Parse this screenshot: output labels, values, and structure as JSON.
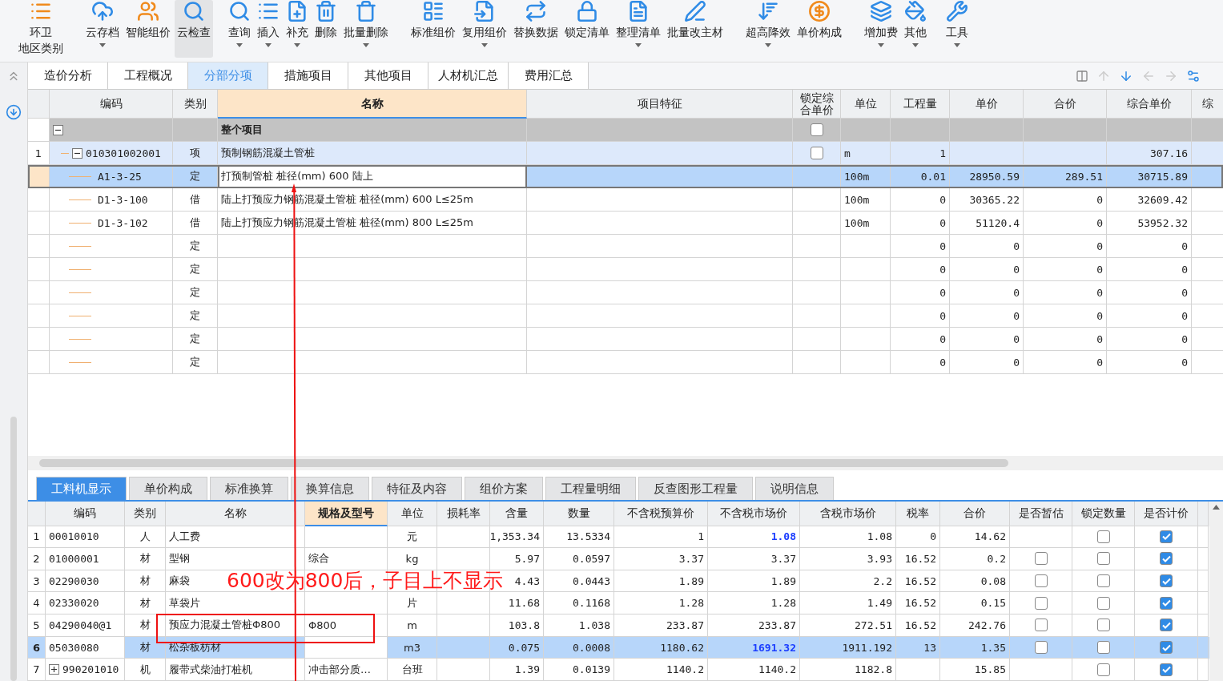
{
  "toolbar": [
    {
      "label": "环卫",
      "label_2": "地区类别",
      "dropdown": false,
      "pressed": false
    },
    {
      "label": "云存档",
      "dropdown": true,
      "pressed": false
    },
    {
      "label": "智能组价",
      "dropdown": false,
      "pressed": false
    },
    {
      "label": "云检查",
      "dropdown": false,
      "pressed": true
    },
    {
      "label": "查询",
      "dropdown": true,
      "pressed": false
    },
    {
      "label": "插入",
      "dropdown": true,
      "pressed": false
    },
    {
      "label": "补充",
      "dropdown": true,
      "pressed": false
    },
    {
      "label": "删除",
      "dropdown": false,
      "pressed": false
    },
    {
      "label": "批量删除",
      "dropdown": true,
      "pressed": false
    },
    {
      "label": "标准组价",
      "dropdown": false,
      "pressed": false
    },
    {
      "label": "复用组价",
      "dropdown": true,
      "pressed": false
    },
    {
      "label": "替换数据",
      "dropdown": false,
      "pressed": false
    },
    {
      "label": "锁定清单",
      "dropdown": false,
      "pressed": false
    },
    {
      "label": "整理清单",
      "dropdown": true,
      "pressed": false
    },
    {
      "label": "批量改主材",
      "dropdown": false,
      "pressed": false
    },
    {
      "label": "超高降效",
      "dropdown": true,
      "pressed": false
    },
    {
      "label": "单价构成",
      "dropdown": false,
      "pressed": false
    },
    {
      "label": "增加费",
      "dropdown": true,
      "pressed": false
    },
    {
      "label": "其他",
      "dropdown": true,
      "pressed": false
    },
    {
      "label": "工具",
      "dropdown": true,
      "pressed": false
    }
  ],
  "tabs": [
    {
      "label": "造价分析",
      "selected": false
    },
    {
      "label": "工程概况",
      "selected": false
    },
    {
      "label": "分部分项",
      "selected": true
    },
    {
      "label": "措施项目",
      "selected": false
    },
    {
      "label": "其他项目",
      "selected": false
    },
    {
      "label": "人材机汇总",
      "selected": false
    },
    {
      "label": "费用汇总",
      "selected": false
    }
  ],
  "upper_table": {
    "columns": [
      {
        "label": "编码",
        "selected": false
      },
      {
        "label": "类别",
        "selected": false
      },
      {
        "label": "名称",
        "selected": true
      },
      {
        "label": "项目特征",
        "selected": false
      },
      {
        "label": "锁定综合单价",
        "selected": false
      },
      {
        "label": "单位",
        "selected": false
      },
      {
        "label": "工程量",
        "selected": false
      },
      {
        "label": "单价",
        "selected": false
      },
      {
        "label": "合价",
        "selected": false
      },
      {
        "label": "综合单价",
        "selected": false
      },
      {
        "label": "综",
        "selected": false
      }
    ],
    "rows": [
      {
        "name": "整个项目",
        "kind": "section",
        "expanded": true,
        "locked": false,
        "selected": false,
        "children": [
          {
            "number": "1",
            "code": "010301002001",
            "type": "项",
            "name": "预制钢筋混凝土管桩",
            "kind": "item",
            "expanded": true,
            "locked": false,
            "selected": false,
            "unit": "m",
            "quantity": "1",
            "composite_price": "307.16",
            "children": [
              {
                "code": "A1-3-25",
                "type": "定",
                "name": "打预制管桩 桩径(mm) 600 陆上",
                "kind": "quota",
                "selected": true,
                "unit": "100m",
                "quantity": "0.01",
                "unit_price": "28950.59",
                "total": "289.51",
                "composite_price": "30715.89"
              },
              {
                "code": "D1-3-100",
                "type": "借",
                "name": "陆上打预应力钢筋混凝土管桩 桩径(mm) 600 L≤25m",
                "kind": "quota",
                "selected": false,
                "unit": "100m",
                "quantity": "0",
                "unit_price": "30365.22",
                "total": "0",
                "composite_price": "32609.42"
              },
              {
                "code": "D1-3-102",
                "type": "借",
                "name": "陆上打预应力钢筋混凝土管桩 桩径(mm) 800 L≤25m",
                "kind": "quota",
                "selected": false,
                "unit": "100m",
                "quantity": "0",
                "unit_price": "51120.4",
                "total": "0",
                "composite_price": "53952.32"
              },
              {
                "type": "定",
                "kind": "quota",
                "selected": false,
                "quantity": "0",
                "unit_price": "0",
                "total": "0",
                "composite_price": "0"
              },
              {
                "type": "定",
                "kind": "quota",
                "selected": false,
                "quantity": "0",
                "unit_price": "0",
                "total": "0",
                "composite_price": "0"
              },
              {
                "type": "定",
                "kind": "quota",
                "selected": false,
                "quantity": "0",
                "unit_price": "0",
                "total": "0",
                "composite_price": "0"
              },
              {
                "type": "定",
                "kind": "quota",
                "selected": false,
                "quantity": "0",
                "unit_price": "0",
                "total": "0",
                "composite_price": "0"
              },
              {
                "type": "定",
                "kind": "quota",
                "selected": false,
                "quantity": "0",
                "unit_price": "0",
                "total": "0",
                "composite_price": "0"
              },
              {
                "type": "定",
                "kind": "quota",
                "selected": false,
                "quantity": "0",
                "unit_price": "0",
                "total": "0",
                "composite_price": "0"
              }
            ]
          }
        ]
      }
    ]
  },
  "lower_tabs": [
    {
      "label": "工料机显示",
      "selected": true
    },
    {
      "label": "单价构成",
      "selected": false
    },
    {
      "label": "标准换算",
      "selected": false
    },
    {
      "label": "换算信息",
      "selected": false
    },
    {
      "label": "特征及内容",
      "selected": false
    },
    {
      "label": "组价方案",
      "selected": false
    },
    {
      "label": "工程量明细",
      "selected": false
    },
    {
      "label": "反查图形工程量",
      "selected": false
    },
    {
      "label": "说明信息",
      "selected": false
    }
  ],
  "lower_table": {
    "columns": [
      {
        "label": "编码",
        "selected": false
      },
      {
        "label": "类别",
        "selected": false
      },
      {
        "label": "名称",
        "selected": false
      },
      {
        "label": "规格及型号",
        "selected": true
      },
      {
        "label": "单位",
        "selected": false
      },
      {
        "label": "损耗率",
        "selected": false
      },
      {
        "label": "含量",
        "selected": false
      },
      {
        "label": "数量",
        "selected": false
      },
      {
        "label": "不含税预算价",
        "selected": false
      },
      {
        "label": "不含税市场价",
        "selected": false
      },
      {
        "label": "含税市场价",
        "selected": false
      },
      {
        "label": "税率",
        "selected": false
      },
      {
        "label": "合价",
        "selected": false
      },
      {
        "label": "是否暂估",
        "selected": false
      },
      {
        "label": "锁定数量",
        "selected": false
      },
      {
        "label": "是否计价",
        "selected": false
      }
    ],
    "rows": [
      {
        "number": "1",
        "code": "00010010",
        "type": "人",
        "name": "人工费",
        "unit": "元",
        "content": "1,353.34",
        "quantity": "13.5334",
        "budget_price": "1",
        "market_price": "1.08",
        "price_changed": true,
        "tax_market_price": "1.08",
        "tax_rate": "0",
        "total": "14.62",
        "lock_quantity": false,
        "priced": true,
        "selected": false
      },
      {
        "number": "2",
        "code": "01000001",
        "type": "材",
        "name": "型钢",
        "spec": "综合",
        "unit": "kg",
        "content": "5.97",
        "quantity": "0.0597",
        "budget_price": "3.37",
        "market_price": "3.37",
        "price_changed": false,
        "tax_market_price": "3.93",
        "tax_rate": "16.52",
        "total": "0.2",
        "provisional": false,
        "lock_quantity": false,
        "priced": true,
        "selected": false
      },
      {
        "number": "3",
        "code": "02290030",
        "type": "材",
        "name": "麻袋",
        "content": "4.43",
        "quantity": "0.0443",
        "budget_price": "1.89",
        "market_price": "1.89",
        "price_changed": false,
        "tax_market_price": "2.2",
        "tax_rate": "16.52",
        "total": "0.08",
        "provisional": false,
        "lock_quantity": false,
        "priced": true,
        "selected": false
      },
      {
        "number": "4",
        "code": "02330020",
        "type": "材",
        "name": "草袋片",
        "unit": "片",
        "content": "11.68",
        "quantity": "0.1168",
        "budget_price": "1.28",
        "market_price": "1.28",
        "price_changed": false,
        "tax_market_price": "1.49",
        "tax_rate": "16.52",
        "total": "0.15",
        "provisional": false,
        "lock_quantity": false,
        "priced": true,
        "selected": false
      },
      {
        "number": "5",
        "code": "04290040@1",
        "type": "材",
        "name": "预应力混凝土管桩Φ800",
        "spec": "Φ800",
        "unit": "m",
        "content": "103.8",
        "quantity": "1.038",
        "budget_price": "233.87",
        "market_price": "233.87",
        "price_changed": false,
        "tax_market_price": "272.51",
        "tax_rate": "16.52",
        "total": "242.76",
        "provisional": false,
        "lock_quantity": false,
        "priced": true,
        "selected": false
      },
      {
        "number": "6",
        "code": "05030080",
        "type": "材",
        "name": "松杂板枋材",
        "unit": "m3",
        "content": "0.075",
        "quantity": "0.0008",
        "budget_price": "1180.62",
        "market_price": "1691.32",
        "price_changed": true,
        "tax_market_price": "1911.192",
        "tax_rate": "13",
        "total": "1.35",
        "provisional": false,
        "lock_quantity": false,
        "priced": true,
        "selected": true
      },
      {
        "number": "7",
        "code": "990201010",
        "expanded": false,
        "type": "机",
        "name": "履带式柴油打桩机",
        "spec": "冲击部分质…",
        "unit": "台班",
        "content": "1.39",
        "quantity": "0.0139",
        "budget_price": "1140.2",
        "market_price": "1140.2",
        "price_changed": false,
        "tax_market_price": "1182.8",
        "total": "15.85",
        "lock_quantity": false,
        "priced": true,
        "selected": false
      }
    ]
  },
  "annotation": {
    "note": "600改为800后，子目上不显示"
  }
}
